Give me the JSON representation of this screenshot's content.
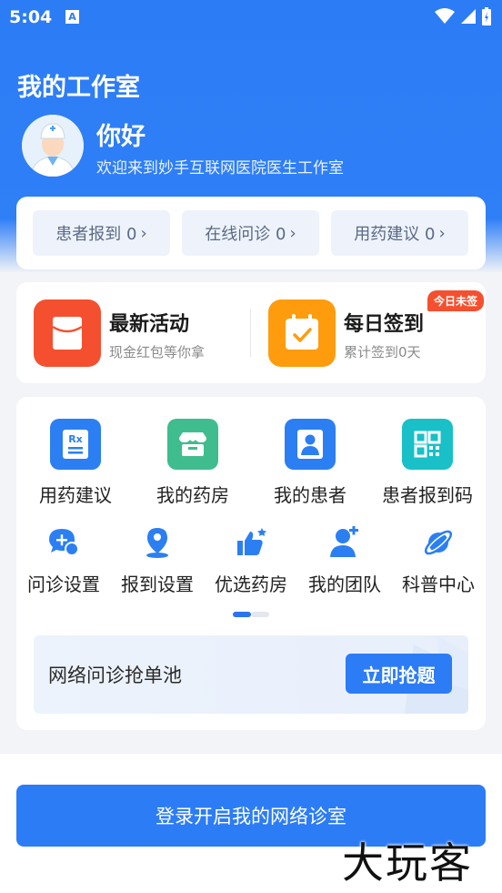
{
  "status_bar": {
    "time": "5:04",
    "notif_letter": "A"
  },
  "header": {
    "title": "我的工作室",
    "greeting": "你好",
    "welcome": "欢迎来到妙手互联网医院医生工作室"
  },
  "stats": [
    {
      "label": "患者报到 0"
    },
    {
      "label": "在线问诊 0"
    },
    {
      "label": "用药建议 0"
    }
  ],
  "promos": {
    "activity": {
      "title": "最新活动",
      "subtitle": "现金红包等你拿"
    },
    "checkin": {
      "title": "每日签到",
      "subtitle": "累计签到0天",
      "badge": "今日未签"
    }
  },
  "menu_main": [
    {
      "label": "用药建议",
      "icon": "rx-icon"
    },
    {
      "label": "我的药房",
      "icon": "pharmacy-icon"
    },
    {
      "label": "我的患者",
      "icon": "patient-icon"
    },
    {
      "label": "患者报到码",
      "icon": "qr-code-icon"
    }
  ],
  "menu_secondary": [
    {
      "label": "问诊设置",
      "icon": "chat-settings-icon"
    },
    {
      "label": "报到设置",
      "icon": "location-pin-icon"
    },
    {
      "label": "优选药房",
      "icon": "thumbs-up-icon"
    },
    {
      "label": "我的团队",
      "icon": "team-icon"
    },
    {
      "label": "科普中心",
      "icon": "planet-icon"
    }
  ],
  "pager": {
    "current_page": 1,
    "total_pages": 2
  },
  "order_pool": {
    "title": "网络问诊抢单池",
    "button": "立即抢题"
  },
  "bottom": {
    "button": "登录开启我的网络诊室"
  },
  "watermark": "大玩客",
  "colors": {
    "primary": "#2c7cf6",
    "accent_red": "#f4502f",
    "accent_orange": "#fe9c0d",
    "accent_green": "#3fbd8e",
    "accent_teal": "#19c0c8"
  }
}
